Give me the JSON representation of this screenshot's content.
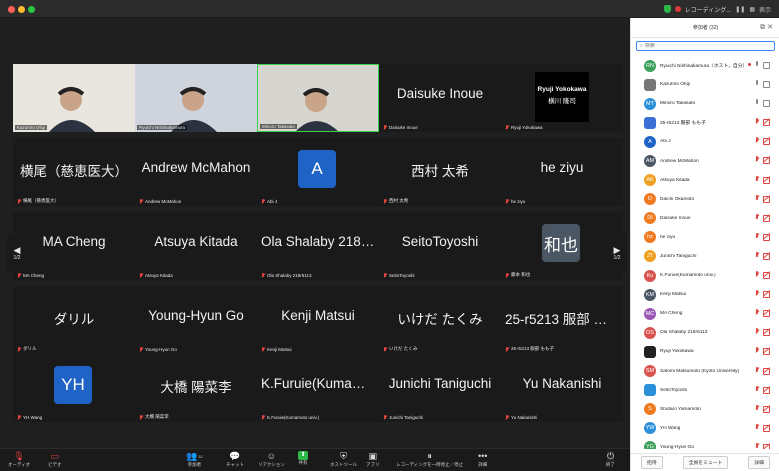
{
  "titlebar": {
    "rec_label": "レコーディング...",
    "view_label": "表示"
  },
  "gallery": {
    "pager_left": "1/2",
    "pager_right": "1/2",
    "tiles": [
      {
        "name": "",
        "label": "Kazuhiro Ofuji",
        "type": "video",
        "muted": false,
        "bg": "#e9e6df"
      },
      {
        "name": "",
        "label": "Ryuichi Nishinakamura",
        "type": "video",
        "muted": false,
        "bg": "#cfd4dc"
      },
      {
        "name": "",
        "label": "Minoru Takasato",
        "type": "video",
        "muted": false,
        "bg": "#d7d5cf",
        "active": true
      },
      {
        "name": "Daisuke Inoue",
        "label": "Daisuke Inoue",
        "type": "name",
        "muted": true
      },
      {
        "name": "",
        "label": "Ryuji Yokokawa",
        "type": "card",
        "card_title": "Ryuji Yokokawa",
        "card_sub": "横川 隆司",
        "muted": true
      },
      {
        "name": "横尾（慈恵医大）",
        "label": "横尾（慈恵医大）",
        "type": "name",
        "muted": true
      },
      {
        "name": "Andrew McMahon",
        "label": "Andrew McMahon",
        "type": "name",
        "muted": true
      },
      {
        "name": "",
        "label": "Abi J",
        "type": "avatar",
        "avatar_text": "A",
        "avatar_color": "#1f63c6",
        "muted": true
      },
      {
        "name": "西村 太希",
        "label": "西村 太希",
        "type": "name",
        "muted": true
      },
      {
        "name": "he ziyu",
        "label": "he ziyu",
        "type": "name",
        "muted": true
      },
      {
        "name": "MA Cheng",
        "label": "MA Cheng",
        "type": "name",
        "muted": true
      },
      {
        "name": "Atsuya Kitada",
        "label": "Atsuya Kitada",
        "type": "name",
        "muted": true
      },
      {
        "name": "Ola Shalaby 218r6113",
        "label": "Ola Shalaby 218r6113",
        "type": "name",
        "muted": true
      },
      {
        "name": "SeitoToyoshi",
        "label": "SeitoToyoshi",
        "type": "name",
        "muted": true
      },
      {
        "name": "",
        "label": "藤本 和也",
        "type": "avatar",
        "avatar_text": "和也",
        "avatar_color": "#4a5663",
        "muted": true
      },
      {
        "name": "ダリル",
        "label": "ダリル",
        "type": "name",
        "muted": true
      },
      {
        "name": "Young-Hyun Go",
        "label": "Young-Hyun Go",
        "type": "name",
        "muted": true
      },
      {
        "name": "Kenji Matsui",
        "label": "Kenji Matsui",
        "type": "name",
        "muted": true
      },
      {
        "name": "いけだ たくみ",
        "label": "いけだ たくみ",
        "type": "name",
        "muted": true
      },
      {
        "name": "25-r5213 服部 もも子",
        "label": "25-r5213 服部 もも子",
        "type": "name",
        "muted": true
      },
      {
        "name": "",
        "label": "YH Wang",
        "type": "avatar",
        "avatar_text": "YH",
        "avatar_color": "#1f63c6",
        "muted": true
      },
      {
        "name": "大橋 陽菜李",
        "label": "大橋 陽菜李",
        "type": "name",
        "muted": true
      },
      {
        "name": "K.Furuie(Kumamoto univ.)",
        "label": "K.Furuie(Kumamoto univ.)",
        "type": "name",
        "muted": true
      },
      {
        "name": "Junichi Taniguchi",
        "label": "Junichi Taniguchi",
        "type": "name",
        "muted": true
      },
      {
        "name": "Yu Nakanishi",
        "label": "Yu Nakanishi",
        "type": "name",
        "muted": true
      }
    ]
  },
  "toolbar": {
    "items": [
      {
        "key": "audio",
        "label": "オーディオ",
        "icon": "mic-icon"
      },
      {
        "key": "video",
        "label": "ビデオ",
        "icon": "video-icon"
      },
      {
        "key": "participants",
        "label": "参加者",
        "icon": "participants-icon",
        "count": "32"
      },
      {
        "key": "chat",
        "label": "チャット",
        "icon": "chat-icon"
      },
      {
        "key": "reactions",
        "label": "リアクション",
        "icon": "reaction-icon"
      },
      {
        "key": "share",
        "label": "共有",
        "icon": "share-icon"
      },
      {
        "key": "host_tools",
        "label": "ホストツール",
        "icon": "shield-icon"
      },
      {
        "key": "apps",
        "label": "アプリ",
        "icon": "apps-icon"
      },
      {
        "key": "recording",
        "label": "レコーディングを一時停止／停止",
        "icon": "recording-icon"
      },
      {
        "key": "more",
        "label": "詳細",
        "icon": "more-icon"
      },
      {
        "key": "end",
        "label": "終了",
        "icon": "end-icon"
      }
    ]
  },
  "panel": {
    "title": "参加者 (32)",
    "search_placeholder": "検索",
    "invite_label": "招待",
    "mute_all_label": "全員をミュート",
    "more_label": "詳細",
    "participants": [
      {
        "initials": "RN",
        "color": "#3aa05a",
        "name": "Ryuichi Nishinakamura（ホスト，自分）",
        "mic": "live",
        "cam": "on",
        "rec": true
      },
      {
        "initials": "",
        "color": "#777",
        "name": "Kazuhiro Ofuji",
        "mic": "live",
        "cam": "on",
        "photo": true
      },
      {
        "initials": "MT",
        "color": "#2b90d9",
        "name": "Minoru Takasato",
        "mic": "live",
        "cam": "on"
      },
      {
        "initials": "",
        "color": "#3a6fd8",
        "name": "25-r5213 服部 もも子",
        "mic": "muted",
        "cam": "off",
        "photo": true
      },
      {
        "initials": "A",
        "color": "#1f63c6",
        "name": "Abi J",
        "mic": "muted",
        "cam": "off"
      },
      {
        "initials": "AM",
        "color": "#4a5663",
        "name": "Andrew McMahon",
        "mic": "muted",
        "cam": "off"
      },
      {
        "initials": "AK",
        "color": "#f0a020",
        "name": "Atsuya Kitada",
        "mic": "muted",
        "cam": "off"
      },
      {
        "initials": "D",
        "color": "#f07a20",
        "name": "Daichi Okamoto",
        "mic": "muted",
        "cam": "off"
      },
      {
        "initials": "DI",
        "color": "#f07a20",
        "name": "Daisuke Inoue",
        "mic": "muted",
        "cam": "off"
      },
      {
        "initials": "hz",
        "color": "#f07a20",
        "name": "he ziyu",
        "mic": "muted",
        "cam": "off"
      },
      {
        "initials": "JT",
        "color": "#f0a020",
        "name": "Junichi Taniguchi",
        "mic": "muted",
        "cam": "off"
      },
      {
        "initials": "Ku",
        "color": "#d9534f",
        "name": "K.Furuie(Kumamoto univ.)",
        "mic": "muted",
        "cam": "off"
      },
      {
        "initials": "KM",
        "color": "#4a5663",
        "name": "Kenji Matsui",
        "mic": "muted",
        "cam": "off"
      },
      {
        "initials": "MC",
        "color": "#9b59b6",
        "name": "MA Cheng",
        "mic": "muted",
        "cam": "off"
      },
      {
        "initials": "OS",
        "color": "#d9534f",
        "name": "Ola Shalaby 218r6113",
        "mic": "muted",
        "cam": "off"
      },
      {
        "initials": "",
        "color": "#222",
        "name": "Ryuji Yokokawa",
        "mic": "muted",
        "cam": "off",
        "photo": true
      },
      {
        "initials": "SM",
        "color": "#d9534f",
        "name": "Satomi Matsumoto (Kyoto University)",
        "mic": "muted",
        "cam": "off"
      },
      {
        "initials": "",
        "color": "#2b90d9",
        "name": "SeitoToyoshi",
        "mic": "muted",
        "cam": "off",
        "photo": true
      },
      {
        "initials": "S",
        "color": "#f07a20",
        "name": "Shutaro Yamamoto",
        "mic": "muted",
        "cam": "off"
      },
      {
        "initials": "YW",
        "color": "#2b90d9",
        "name": "YH Wang",
        "mic": "muted",
        "cam": "off"
      },
      {
        "initials": "YG",
        "color": "#3aa05a",
        "name": "Young-Hyun Go",
        "mic": "muted",
        "cam": "off"
      }
    ]
  }
}
